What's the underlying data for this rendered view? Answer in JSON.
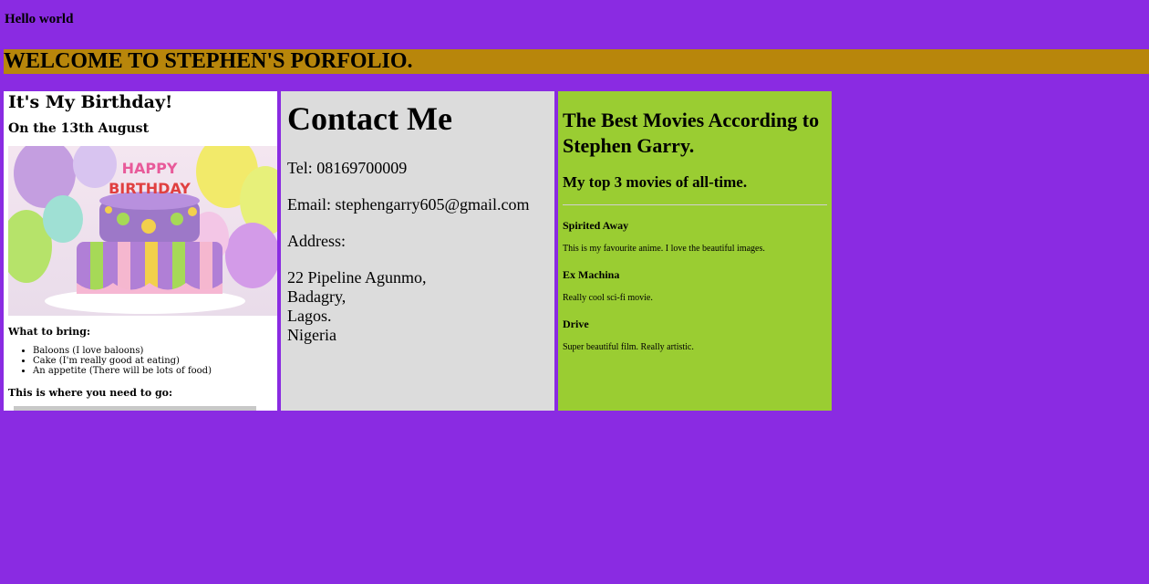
{
  "hello": "Hello world",
  "banner": "WELCOME TO STEPHEN'S PORFOLIO.",
  "birthday": {
    "title": "It's My Birthday!",
    "subtitle": "On the 13th August",
    "cake_text": "HAPPY BIRTHDAY",
    "bring_heading": "What to bring:",
    "items": [
      "Baloons (I love baloons)",
      "Cake (I'm really good at eating)",
      "An appetite (There will be lots of food)"
    ],
    "where_heading": "This is where you need to go:"
  },
  "contact": {
    "title": "Contact Me",
    "tel": "Tel: 08169700009",
    "email": "Email: stephengarry605@gmail.com",
    "address_label": "Address:",
    "address_lines": [
      "22 Pipeline Agunmo,",
      "Badagry,",
      "Lagos.",
      "Nigeria"
    ]
  },
  "movies": {
    "title": "The Best Movies According to Stephen Garry.",
    "subtitle": "My top 3 movies of all-time.",
    "list": [
      {
        "name": "Spirited Away",
        "desc": "This is my favourite anime. I love the beautiful images."
      },
      {
        "name": "Ex Machina",
        "desc": "Really cool sci-fi movie."
      },
      {
        "name": "Drive",
        "desc": "Super beautiful film. Really artistic."
      }
    ]
  },
  "colors": {
    "page_bg": "#8a2be2",
    "banner_bg": "#b8860b",
    "contact_bg": "#dcdcdc",
    "movies_bg": "#9acd32"
  }
}
